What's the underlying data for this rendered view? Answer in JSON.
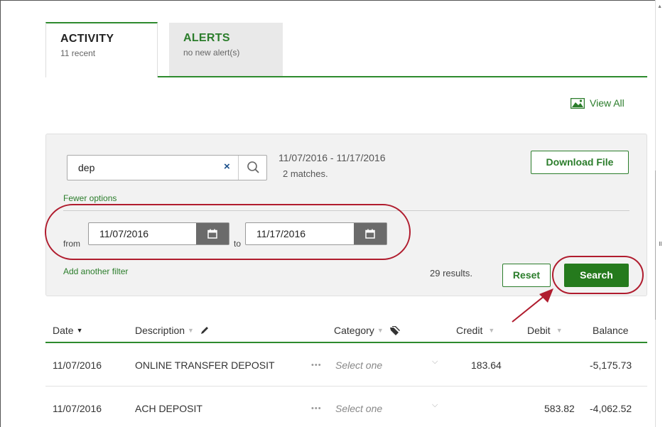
{
  "tabs": [
    {
      "title": "ACTIVITY",
      "subtitle": "11 recent"
    },
    {
      "title": "ALERTS",
      "subtitle": "no new alert(s)"
    }
  ],
  "view_all": "View All",
  "search": {
    "value": "dep",
    "clear_glyph": "×",
    "date_range": "11/07/2016 - 11/17/2016",
    "matches": "2 matches."
  },
  "download_button": "Download File",
  "fewer_options": "Fewer options",
  "date_filter": {
    "from_label": "from",
    "from_value": "11/07/2016",
    "to_label": "to",
    "to_value": "11/17/2016"
  },
  "add_filter": "Add another filter",
  "results_count": "29 results.",
  "reset_button": "Reset",
  "search_button": "Search",
  "table": {
    "columns": [
      "Date",
      "Description",
      "Category",
      "Credit",
      "Debit",
      "Balance"
    ],
    "rows": [
      {
        "date": "11/07/2016",
        "description": "ONLINE TRANSFER DEPOSIT",
        "category": "Select one",
        "credit": "183.64",
        "debit": "",
        "balance": "-5,175.73"
      },
      {
        "date": "11/07/2016",
        "description": "ACH DEPOSIT",
        "category": "Select one",
        "credit": "",
        "debit": "583.82",
        "balance": "-4,062.52"
      }
    ]
  },
  "colors": {
    "brand_green": "#2b7d2b",
    "annotation_red": "#b01c2e"
  }
}
